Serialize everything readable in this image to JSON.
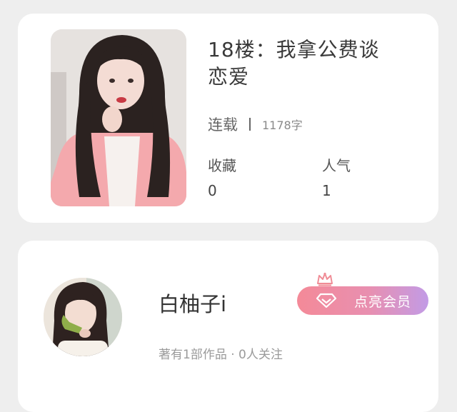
{
  "book": {
    "title_line1": "18楼：我拿公费谈",
    "title_line2": "恋爱",
    "status": "连载",
    "word_count": "1178字",
    "stats": [
      {
        "label": "收藏",
        "value": "0"
      },
      {
        "label": "人气",
        "value": "1"
      }
    ]
  },
  "author": {
    "name": "白柚子i",
    "meta": "著有1部作品 · 0人关注",
    "vip_button_label": "点亮会员"
  },
  "icons": [
    "crown-icon",
    "diamond-icon"
  ],
  "colors": {
    "vip_gradient_start": "#f48a98",
    "vip_gradient_end": "#c29be6",
    "crown": "#f08c96"
  }
}
